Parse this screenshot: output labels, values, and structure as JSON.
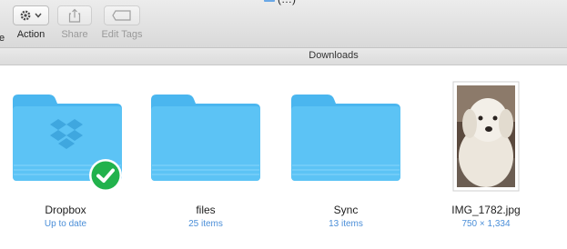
{
  "window": {
    "title_fragment": "(…)",
    "pathbar_title": "Downloads"
  },
  "toolbar": {
    "partial_label": "e",
    "action_label": "Action",
    "share_label": "Share",
    "edit_tags_label": "Edit Tags"
  },
  "items": [
    {
      "name": "Dropbox",
      "subtitle": "Up to date",
      "icon": "dropbox-folder-icon",
      "badge": "synced-check-badge"
    },
    {
      "name": "files",
      "subtitle": "25 items",
      "icon": "folder-icon"
    },
    {
      "name": "Sync",
      "subtitle": "13 items",
      "icon": "folder-icon"
    },
    {
      "name": "IMG_1782.jpg",
      "subtitle": "750 × 1,334",
      "icon": "image-thumbnail"
    }
  ],
  "colors": {
    "folder_blue": "#5cc3f5",
    "subtitle_blue": "#4a8ed8",
    "badge_green": "#22b24c"
  }
}
